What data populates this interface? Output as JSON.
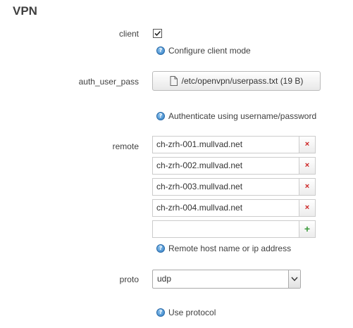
{
  "section": {
    "title": "VPN"
  },
  "client": {
    "label": "client",
    "checked": true,
    "help": "Configure client mode",
    "help_icon": "help-icon"
  },
  "auth_user_pass": {
    "label": "auth_user_pass",
    "file": "/etc/openvpn/userpass.txt (19 B)",
    "file_icon": "document-icon",
    "help": "Authenticate using username/password"
  },
  "remote": {
    "label": "remote",
    "entries": [
      "ch-zrh-001.mullvad.net",
      "ch-zrh-002.mullvad.net",
      "ch-zrh-003.mullvad.net",
      "ch-zrh-004.mullvad.net"
    ],
    "new_entry": "",
    "remove_symbol": "×",
    "add_symbol": "+",
    "help": "Remote host name or ip address"
  },
  "proto": {
    "label": "proto",
    "selected": "udp",
    "help": "Use protocol"
  },
  "colors": {
    "remove": "#cc2222",
    "add": "#3a9a3a",
    "help_icon": "#2f7ec5"
  }
}
